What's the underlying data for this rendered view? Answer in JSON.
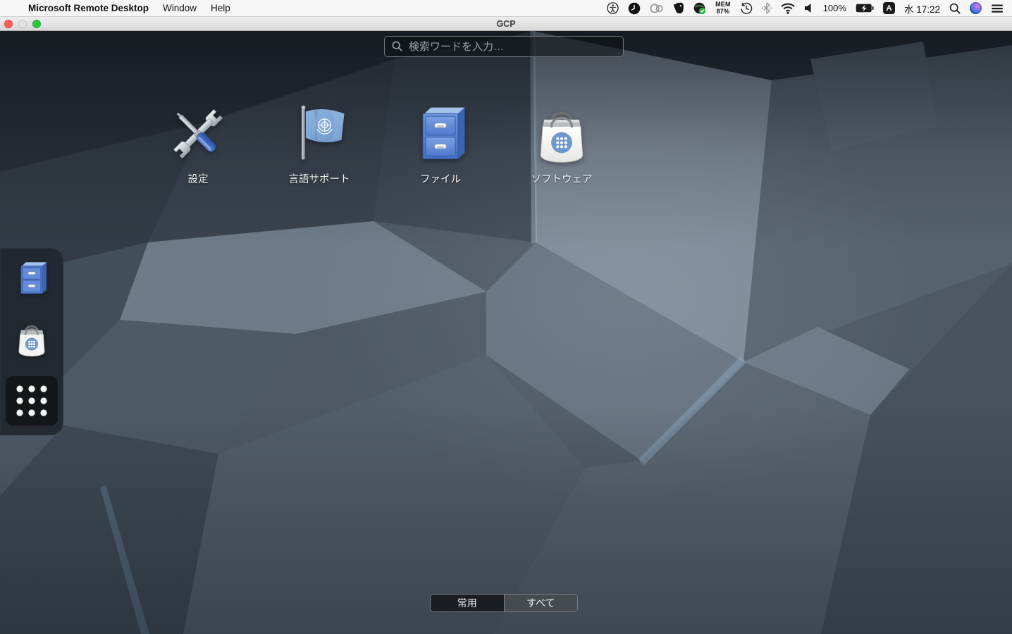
{
  "menu_bar": {
    "app_name": "Microsoft Remote Desktop",
    "menus": [
      {
        "label": "Window"
      },
      {
        "label": "Help"
      }
    ],
    "status": {
      "mem_line1": "MEM",
      "mem_line2": "87%",
      "battery_percent": "100%",
      "input_badge": "A",
      "clock": "水 17:22"
    }
  },
  "window": {
    "title": "GCP"
  },
  "overview": {
    "search": {
      "placeholder": "検索ワードを入力…"
    },
    "apps": [
      {
        "label": "設定",
        "icon": "settings-icon"
      },
      {
        "label": "言語サポート",
        "icon": "language-support-icon"
      },
      {
        "label": "ファイル",
        "icon": "files-icon"
      },
      {
        "label": "ソフトウェア",
        "icon": "software-icon"
      }
    ],
    "dock_items": [
      {
        "icon": "files-icon"
      },
      {
        "icon": "software-icon"
      },
      {
        "icon": "show-applications-icon"
      }
    ],
    "view_toggle": {
      "options": [
        {
          "label": "常用",
          "selected": false
        },
        {
          "label": "すべて",
          "selected": true
        }
      ]
    }
  },
  "colors": {
    "menubar_bg": "#f6f6f6",
    "traffic_red": "#ff5f57",
    "traffic_green": "#2ac840",
    "search_border": "#70767b",
    "dash_bg": "rgba(33,39,45,0.93)",
    "files_blue": "#4a74c8",
    "software_circle_blue": "#6f97ca",
    "un_flag_blue": "#7fa8d6",
    "wallpaper_light": "#7d8997",
    "wallpaper_dark": "#29303a",
    "toggle_selected_bg": "#454b51"
  }
}
